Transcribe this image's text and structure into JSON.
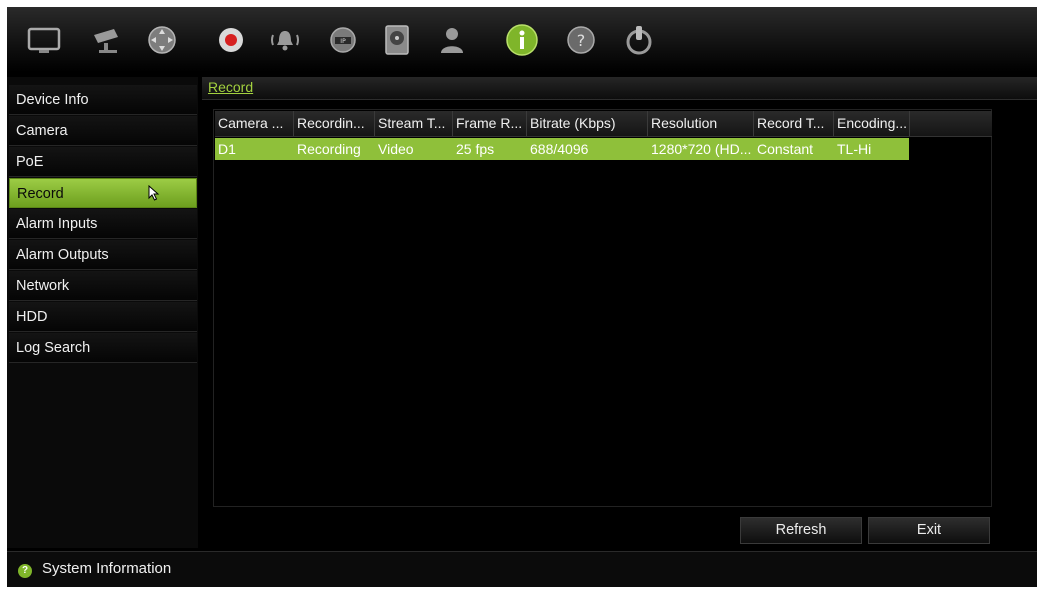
{
  "toolbar": {
    "icons": [
      "monitor-icon",
      "camera-icon",
      "ptz-icon",
      "record-icon",
      "alarm-icon",
      "network-icon",
      "hdd-icon",
      "user-icon",
      "info-icon",
      "help-icon",
      "power-icon"
    ],
    "active_icon": "info-icon"
  },
  "sidebar": {
    "items": [
      {
        "label": "Device Info"
      },
      {
        "label": "Camera"
      },
      {
        "label": "PoE"
      },
      {
        "label": "Record"
      },
      {
        "label": "Alarm Inputs"
      },
      {
        "label": "Alarm Outputs"
      },
      {
        "label": "Network"
      },
      {
        "label": "HDD"
      },
      {
        "label": "Log Search"
      }
    ],
    "active_item": "Record"
  },
  "page": {
    "title": "Record"
  },
  "table": {
    "columns": [
      "Camera ...",
      "Recordin...",
      "Stream T...",
      "Frame R...",
      "Bitrate (Kbps)",
      "Resolution",
      "Record T...",
      "Encoding..."
    ],
    "rows": [
      {
        "cells": [
          "D1",
          "Recording",
          "Video",
          "25 fps",
          "688/4096",
          "1280*720 (HD...",
          "Constant",
          "TL-Hi"
        ]
      }
    ]
  },
  "buttons": {
    "refresh_label": "Refresh",
    "exit_label": "Exit"
  },
  "status": {
    "text": "System Information"
  },
  "colors": {
    "accent": "#8fc03a",
    "title": "#a3d13f",
    "record_red": "#d62020"
  }
}
